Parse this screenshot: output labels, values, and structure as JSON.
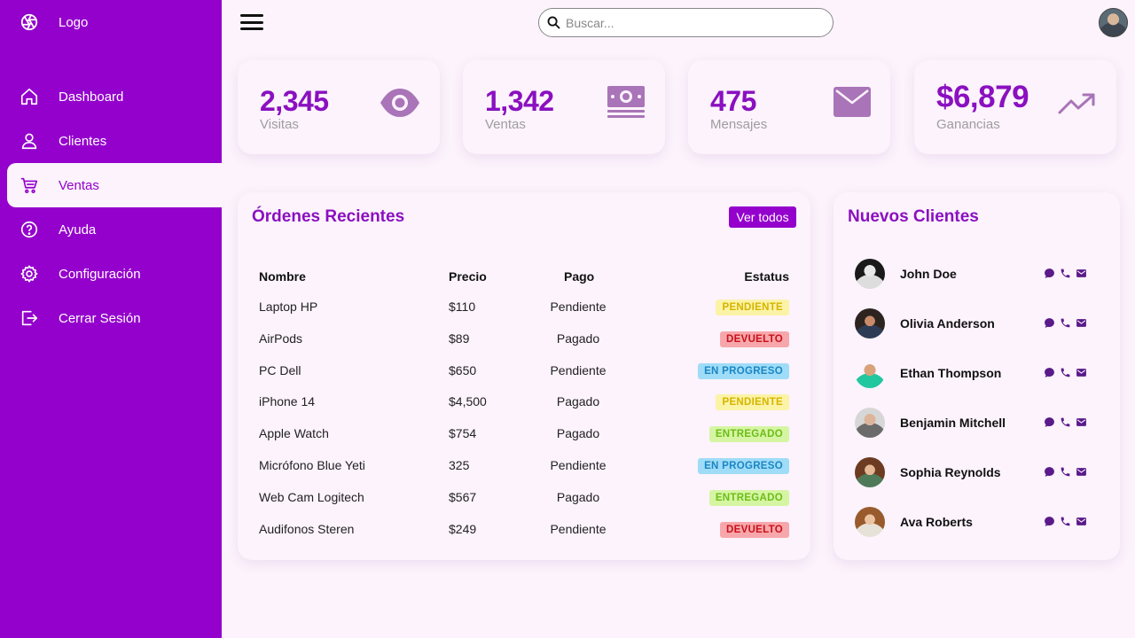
{
  "sidebar": {
    "logo_label": "Logo",
    "items": [
      {
        "label": "Dashboard",
        "icon": "home-icon"
      },
      {
        "label": "Clientes",
        "icon": "user-icon"
      },
      {
        "label": "Ventas",
        "icon": "cart-icon",
        "active": true
      },
      {
        "label": "Ayuda",
        "icon": "help-icon"
      },
      {
        "label": "Configuración",
        "icon": "gear-icon"
      },
      {
        "label": "Cerrar Sesión",
        "icon": "logout-icon"
      }
    ]
  },
  "header": {
    "search_placeholder": "Buscar..."
  },
  "stats": [
    {
      "value": "2,345",
      "label": "Visitas",
      "icon": "eye-icon"
    },
    {
      "value": "1,342",
      "label": "Ventas",
      "icon": "money-icon"
    },
    {
      "value": "475",
      "label": "Mensajes",
      "icon": "mail-icon"
    },
    {
      "value": "$6,879",
      "label": "Ganancias",
      "icon": "trending-up-icon"
    }
  ],
  "orders": {
    "title": "Órdenes Recientes",
    "view_all": "Ver todos",
    "columns": [
      "Nombre",
      "Precio",
      "Pago",
      "Estatus"
    ],
    "rows": [
      {
        "name": "Laptop HP",
        "price": "$110",
        "payment": "Pendiente",
        "status": "PENDIENTE"
      },
      {
        "name": "AirPods",
        "price": "$89",
        "payment": "Pagado",
        "status": "DEVUELTO"
      },
      {
        "name": "PC Dell",
        "price": "$650",
        "payment": "Pendiente",
        "status": "EN PROGRESO"
      },
      {
        "name": "iPhone 14",
        "price": "$4,500",
        "payment": "Pagado",
        "status": "PENDIENTE"
      },
      {
        "name": "Apple Watch",
        "price": "$754",
        "payment": "Pagado",
        "status": "ENTREGADO"
      },
      {
        "name": "Micrófono Blue Yeti",
        "price": "325",
        "payment": "Pendiente",
        "status": "EN PROGRESO"
      },
      {
        "name": "Web Cam Logitech",
        "price": "$567",
        "payment": "Pagado",
        "status": "ENTREGADO"
      },
      {
        "name": "Audifonos Steren",
        "price": "$249",
        "payment": "Pendiente",
        "status": "DEVUELTO"
      }
    ],
    "status_colors": {
      "PENDIENTE": {
        "bg": "#fbf3a6",
        "fg": "#d6b400"
      },
      "DEVUELTO": {
        "bg": "#f7a7ab",
        "fg": "#c8101a"
      },
      "EN PROGRESO": {
        "bg": "#9fdcf7",
        "fg": "#1a86c4"
      },
      "ENTREGADO": {
        "bg": "#d6f5a3",
        "fg": "#6cbd18"
      }
    }
  },
  "clients": {
    "title": "Nuevos Clientes",
    "items": [
      {
        "name": "John Doe"
      },
      {
        "name": "Olivia Anderson"
      },
      {
        "name": "Ethan Thompson"
      },
      {
        "name": "Benjamin Mitchell"
      },
      {
        "name": "Sophia Reynolds"
      },
      {
        "name": "Ava Roberts"
      }
    ],
    "actions": [
      "chat-icon",
      "phone-icon",
      "mail-icon"
    ]
  },
  "colors": {
    "accent": "#9400cc",
    "background": "#fcf3fc",
    "icon_muted": "#a974b8",
    "action_icon": "#5a1a8a"
  }
}
